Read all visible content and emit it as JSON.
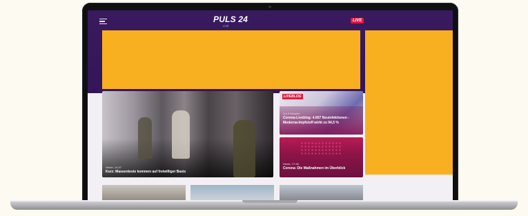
{
  "header": {
    "logo_text": "PULS 24",
    "logo_subtitle": "LIVE",
    "live_badge": "LIVE",
    "menu_icon": "hamburger-icon"
  },
  "hero_article": {
    "meta": "Heute, 14:47",
    "title": "Kurz: Massentests kommen auf freiwilliger Basis"
  },
  "side_articles": [
    {
      "badge": "LIVEBLOG",
      "meta": "Vor 9 Minuten",
      "title": "Corona-Liveblog: 4.657 Neuinfektionen - Moderna-Impfstoff wirkt zu 94,5 %"
    },
    {
      "meta": "Heute, 17:46",
      "title": "Corona: Die Maßnahmen im Überblick"
    }
  ],
  "colors": {
    "brand_purple": "#3a1a5e",
    "ad_yellow": "#f8b021",
    "live_red": "#e21a3d"
  }
}
